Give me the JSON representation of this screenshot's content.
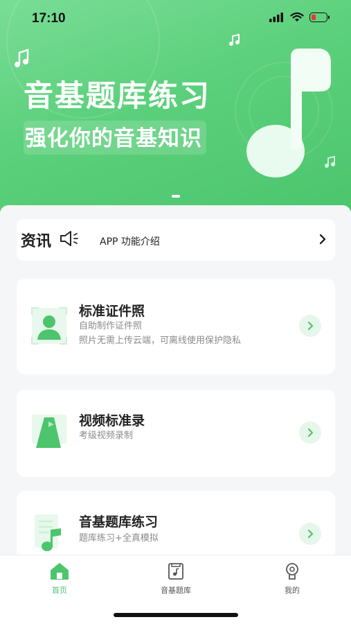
{
  "status_bar": {
    "time": "17:10"
  },
  "banner": {
    "title": "音基题库练习",
    "subtitle": "强化你的音基知识"
  },
  "news": {
    "title": "资讯",
    "text": "APP 功能介绍"
  },
  "cards": [
    {
      "title": "标准证件照",
      "desc1": "自助制作证件照",
      "desc2": "照片无需上传云端，可离线使用保护隐私"
    },
    {
      "title": "视频标准录",
      "desc1": "考级视频录制"
    },
    {
      "title": "音基题库练习",
      "desc1": "题库练习+全真模拟"
    }
  ],
  "tabbar": {
    "items": [
      {
        "label": "首页",
        "icon": "home-icon",
        "active": true
      },
      {
        "label": "音基题库",
        "icon": "music-book-icon",
        "active": false
      },
      {
        "label": "我的",
        "icon": "profile-icon",
        "active": false
      }
    ]
  },
  "colors": {
    "accent": "#4cc56d",
    "accent_light": "#e7f6ea",
    "text_primary": "#222222",
    "text_secondary": "#8a8a8a"
  }
}
